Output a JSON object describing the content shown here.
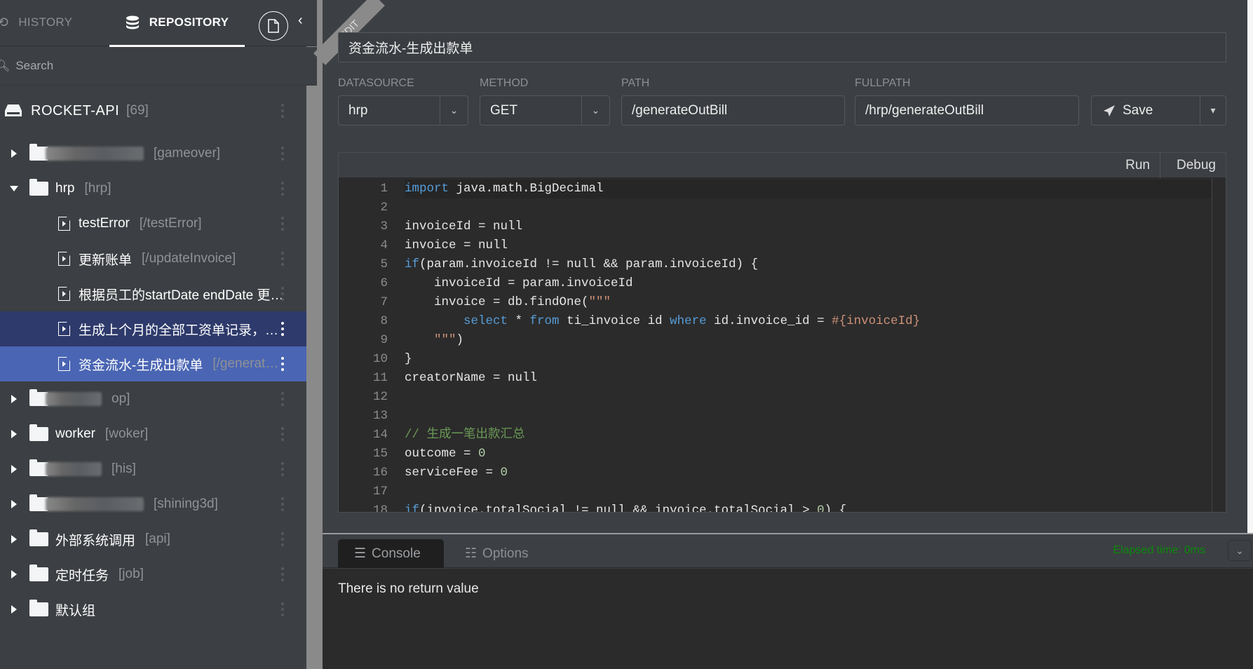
{
  "sidebar": {
    "tabs": {
      "history": "HISTORY",
      "repository": "REPOSITORY"
    },
    "search_placeholder": "Search",
    "root": {
      "name": "ROCKET-API",
      "count": "[69]"
    },
    "tree": [
      {
        "type": "folder",
        "name": "",
        "blurred": true,
        "tag": "[gameover]",
        "expanded": false
      },
      {
        "type": "folder",
        "name": "hrp",
        "tag": "[hrp]",
        "expanded": true
      },
      {
        "type": "api",
        "name": "testError",
        "tag": "[/testError]"
      },
      {
        "type": "api",
        "name": "更新账单",
        "tag": "[/updateInvoice]"
      },
      {
        "type": "api",
        "name": "根据员工的startDate endDate 更…",
        "tag": ""
      },
      {
        "type": "api",
        "name": "生成上个月的全部工资单记录，…",
        "tag": "",
        "state": "hover"
      },
      {
        "type": "api",
        "name": "资金流水-生成出款单",
        "tag": "[/generat…",
        "state": "selected"
      },
      {
        "type": "folder",
        "name": "",
        "blurred": true,
        "tag": "op]",
        "expanded": false
      },
      {
        "type": "folder",
        "name": "worker",
        "tag": "[woker]",
        "expanded": false
      },
      {
        "type": "folder",
        "name": "",
        "blurred": true,
        "tag": "[his]",
        "expanded": false
      },
      {
        "type": "folder",
        "name": "",
        "blurred": true,
        "tag": "[shining3d]",
        "expanded": false
      },
      {
        "type": "folder",
        "name": "外部系统调用",
        "tag": "[api]",
        "expanded": false
      },
      {
        "type": "folder",
        "name": "定时任务",
        "tag": "[job]",
        "expanded": false
      },
      {
        "type": "folder",
        "name": "默认组",
        "tag": "",
        "expanded": false
      }
    ]
  },
  "editor": {
    "mode_ribbon": "EDIT",
    "title": "资金流水-生成出款单",
    "datasource": {
      "label": "DATASOURCE",
      "value": "hrp"
    },
    "method": {
      "label": "METHOD",
      "value": "GET"
    },
    "path": {
      "label": "PATH",
      "value": "/generateOutBill"
    },
    "fullpath": {
      "label": "FULLPATH",
      "value": "/hrp/generateOutBill"
    },
    "save_label": "Save",
    "run_label": "Run",
    "debug_label": "Debug",
    "code": [
      [
        [
          "kw",
          "import"
        ],
        [
          "t",
          " java.math.BigDecimal"
        ]
      ],
      [],
      [
        [
          "t",
          "invoiceId = null"
        ]
      ],
      [
        [
          "t",
          "invoice = null"
        ]
      ],
      [
        [
          "kw",
          "if"
        ],
        [
          "t",
          "(param.invoiceId != null && param.invoiceId) {"
        ]
      ],
      [
        [
          "t",
          "    invoiceId = param.invoiceId"
        ]
      ],
      [
        [
          "t",
          "    invoice = db.findOne("
        ],
        [
          "str",
          "\"\"\""
        ]
      ],
      [
        [
          "t",
          "        "
        ],
        [
          "kw",
          "select"
        ],
        [
          "t",
          " * "
        ],
        [
          "kw",
          "from"
        ],
        [
          "t",
          " ti_invoice id "
        ],
        [
          "kw",
          "where"
        ],
        [
          "t",
          " id.invoice_id = "
        ],
        [
          "str",
          "#{invoiceId}"
        ]
      ],
      [
        [
          "t",
          "    "
        ],
        [
          "str",
          "\"\"\""
        ],
        [
          "t",
          ")"
        ]
      ],
      [
        [
          "t",
          "}"
        ]
      ],
      [
        [
          "t",
          "creatorName = null"
        ]
      ],
      [],
      [],
      [
        [
          "cm",
          "// 生成一笔出款汇总"
        ]
      ],
      [
        [
          "t",
          "outcome = "
        ],
        [
          "num",
          "0"
        ]
      ],
      [
        [
          "t",
          "serviceFee = "
        ],
        [
          "num",
          "0"
        ]
      ],
      [],
      [
        [
          "kw",
          "if"
        ],
        [
          "t",
          "(invoice.totalSocial != null && invoice.totalSocial > "
        ],
        [
          "num",
          "0"
        ],
        [
          "t",
          ") {"
        ]
      ]
    ]
  },
  "console": {
    "tabs": {
      "console": "Console",
      "options": "Options"
    },
    "elapsed": "Elapsed time: 0ms",
    "output": "There is no return value"
  },
  "colors": {
    "selected_row": "#4a65b3",
    "hover_row": "#2e3a6b",
    "elapsed": "#0a8a0a",
    "keyword": "#569cd6"
  }
}
